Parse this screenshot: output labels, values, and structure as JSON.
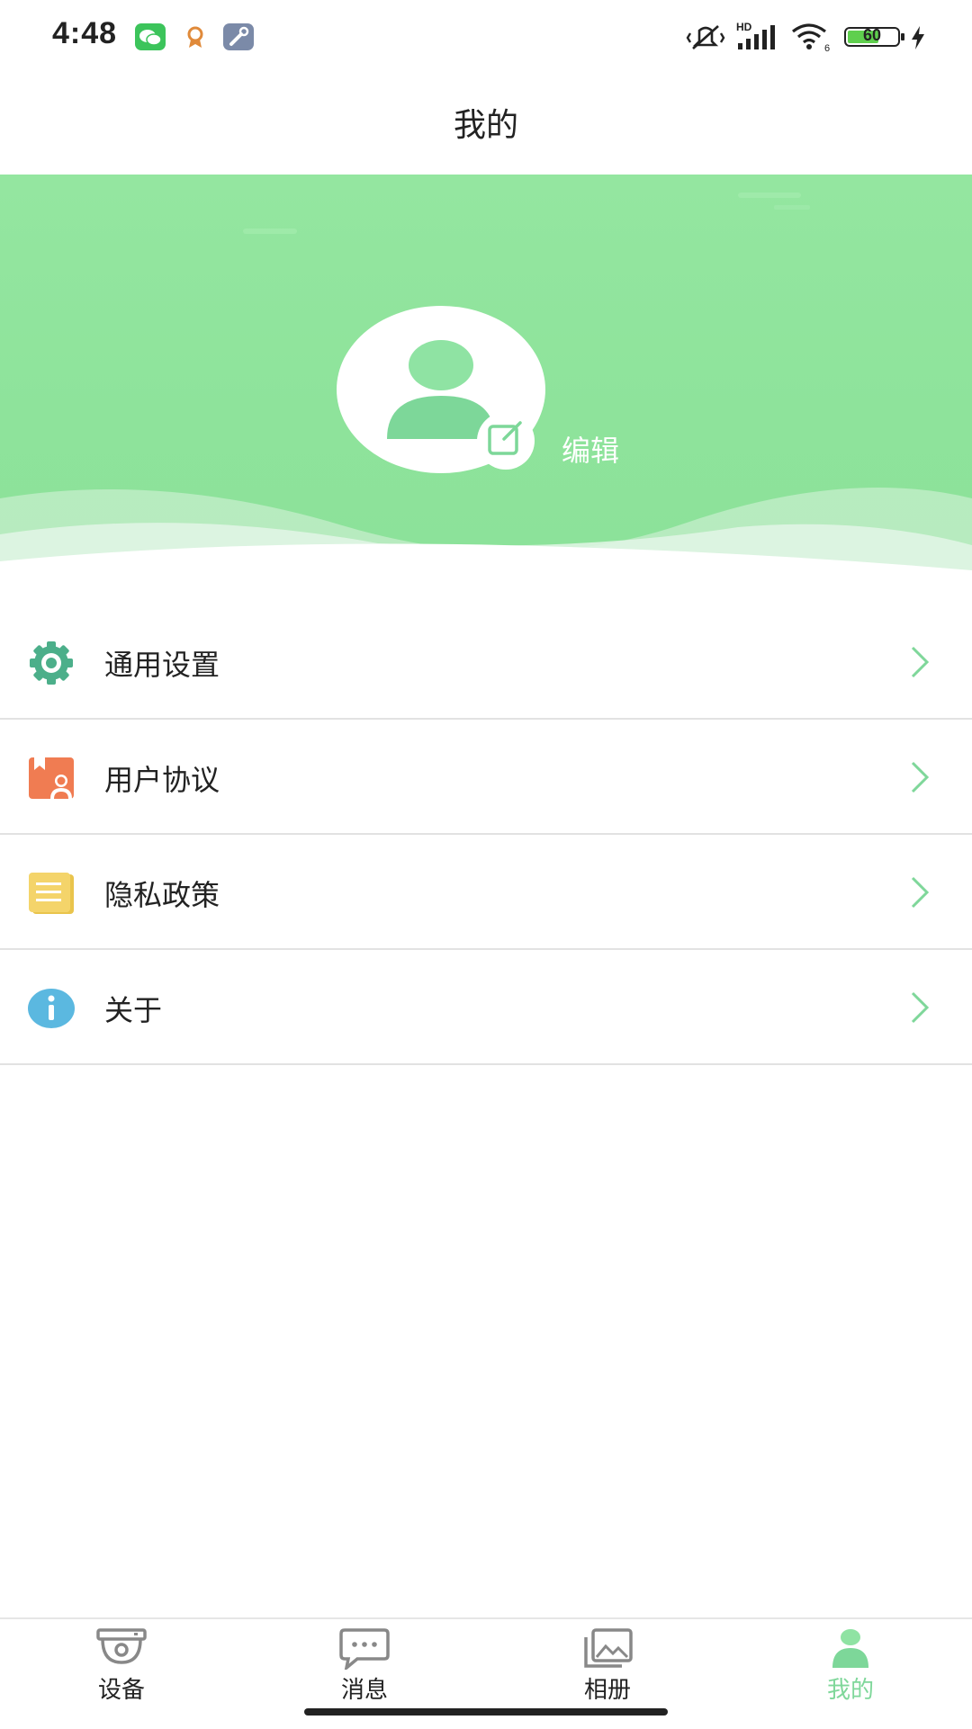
{
  "status_bar": {
    "time": "4:48",
    "notification_icons": [
      "wechat-icon",
      "badge-app-icon",
      "tools-app-icon"
    ],
    "battery_level": "60",
    "system_icons": [
      "vibrate-mute-icon",
      "hd-signal-icon",
      "wifi-icon",
      "battery-icon",
      "charging-icon"
    ]
  },
  "header": {
    "title": "我的"
  },
  "profile": {
    "edit_label": "编辑",
    "colors": {
      "banner": "#8ee39b",
      "avatar_figure": "#7dd799"
    }
  },
  "menu": {
    "items": [
      {
        "label": "通用设置",
        "icon": "gear-icon",
        "color": "#4caf8a"
      },
      {
        "label": "用户协议",
        "icon": "user-agreement-icon",
        "color": "#f07c52"
      },
      {
        "label": "隐私政策",
        "icon": "document-icon",
        "color": "#f4d46a"
      },
      {
        "label": "关于",
        "icon": "info-icon",
        "color": "#5bb8e0"
      }
    ],
    "chevron_color": "#7fd79a"
  },
  "tabbar": {
    "tabs": [
      {
        "label": "设备",
        "icon": "camera-device-icon",
        "active": false
      },
      {
        "label": "消息",
        "icon": "message-icon",
        "active": false
      },
      {
        "label": "相册",
        "icon": "album-icon",
        "active": false
      },
      {
        "label": "我的",
        "icon": "profile-icon",
        "active": true
      }
    ],
    "active_color": "#7fd79a"
  }
}
